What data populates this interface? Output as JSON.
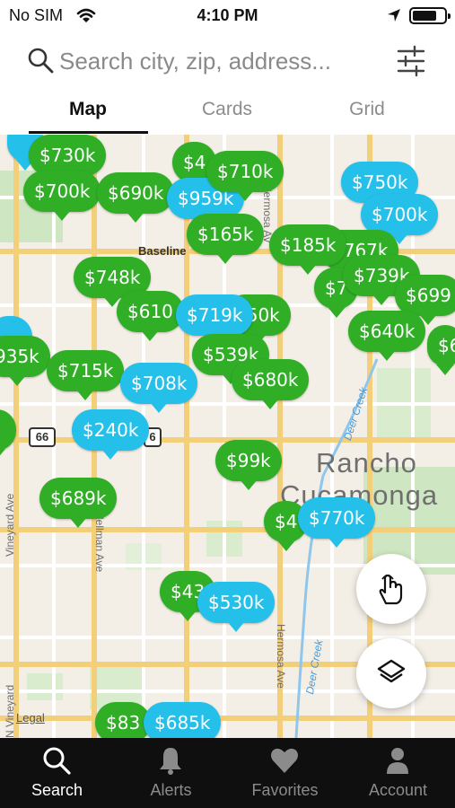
{
  "status": {
    "carrier": "No SIM",
    "time": "4:10 PM"
  },
  "search": {
    "placeholder": "Search city, zip, address..."
  },
  "tabs": [
    {
      "label": "Map",
      "active": true
    },
    {
      "label": "Cards",
      "active": false
    },
    {
      "label": "Grid",
      "active": false
    }
  ],
  "map": {
    "labels": {
      "city1": "Rancho",
      "city2": "Cucamonga",
      "baseline": "Baseline",
      "hermosa1": "Hermosa Av",
      "hermosa2": "Hermosa Ave",
      "vineyard1": "Vineyard Ave",
      "vineyard2": "N Vineyard",
      "hellman": "Hellman Ave",
      "deer1": "Deer Creek",
      "deer2": "Deer Creek",
      "legal": "Legal",
      "route1": "66",
      "route2": "6"
    },
    "pins": [
      {
        "price": "$730k",
        "color": "green"
      },
      {
        "price": "$700k",
        "color": "green"
      },
      {
        "price": "$690k",
        "color": "green"
      },
      {
        "price": "$4",
        "color": "green"
      },
      {
        "price": "$959k",
        "color": "blue"
      },
      {
        "price": "$710k",
        "color": "green"
      },
      {
        "price": "$750k",
        "color": "blue"
      },
      {
        "price": "$700k",
        "color": "blue"
      },
      {
        "price": "$165k",
        "color": "green"
      },
      {
        "price": "$185k",
        "color": "green"
      },
      {
        "price": "$767k",
        "color": "green"
      },
      {
        "price": "$748k",
        "color": "green"
      },
      {
        "price": "$7",
        "color": "green"
      },
      {
        "price": "$739k",
        "color": "green"
      },
      {
        "price": "$699",
        "color": "green"
      },
      {
        "price": "$610",
        "color": "green"
      },
      {
        "price": "$719k",
        "color": "blue"
      },
      {
        "price": "750k",
        "color": "green"
      },
      {
        "price": "$640k",
        "color": "green"
      },
      {
        "price": "$6",
        "color": "green"
      },
      {
        "price": "935k",
        "color": "green"
      },
      {
        "price": "$715k",
        "color": "green"
      },
      {
        "price": "$539k",
        "color": "green"
      },
      {
        "price": "$708k",
        "color": "blue"
      },
      {
        "price": "$680k",
        "color": "green"
      },
      {
        "price": "$240k",
        "color": "blue"
      },
      {
        "price": "$99k",
        "color": "green"
      },
      {
        "price": "$689k",
        "color": "green"
      },
      {
        "price": "$4",
        "color": "green"
      },
      {
        "price": "$770k",
        "color": "blue"
      },
      {
        "price": "$43",
        "color": "green"
      },
      {
        "price": "$530k",
        "color": "blue"
      },
      {
        "price": "$83",
        "color": "green"
      },
      {
        "price": "$685k",
        "color": "blue"
      }
    ]
  },
  "nav": [
    {
      "label": "Search",
      "active": true
    },
    {
      "label": "Alerts",
      "active": false
    },
    {
      "label": "Favorites",
      "active": false
    },
    {
      "label": "Account",
      "active": false
    }
  ],
  "colors": {
    "pin_green": "#2fae26",
    "pin_blue": "#24c0ea",
    "nav_bg": "#0f0f0f"
  }
}
